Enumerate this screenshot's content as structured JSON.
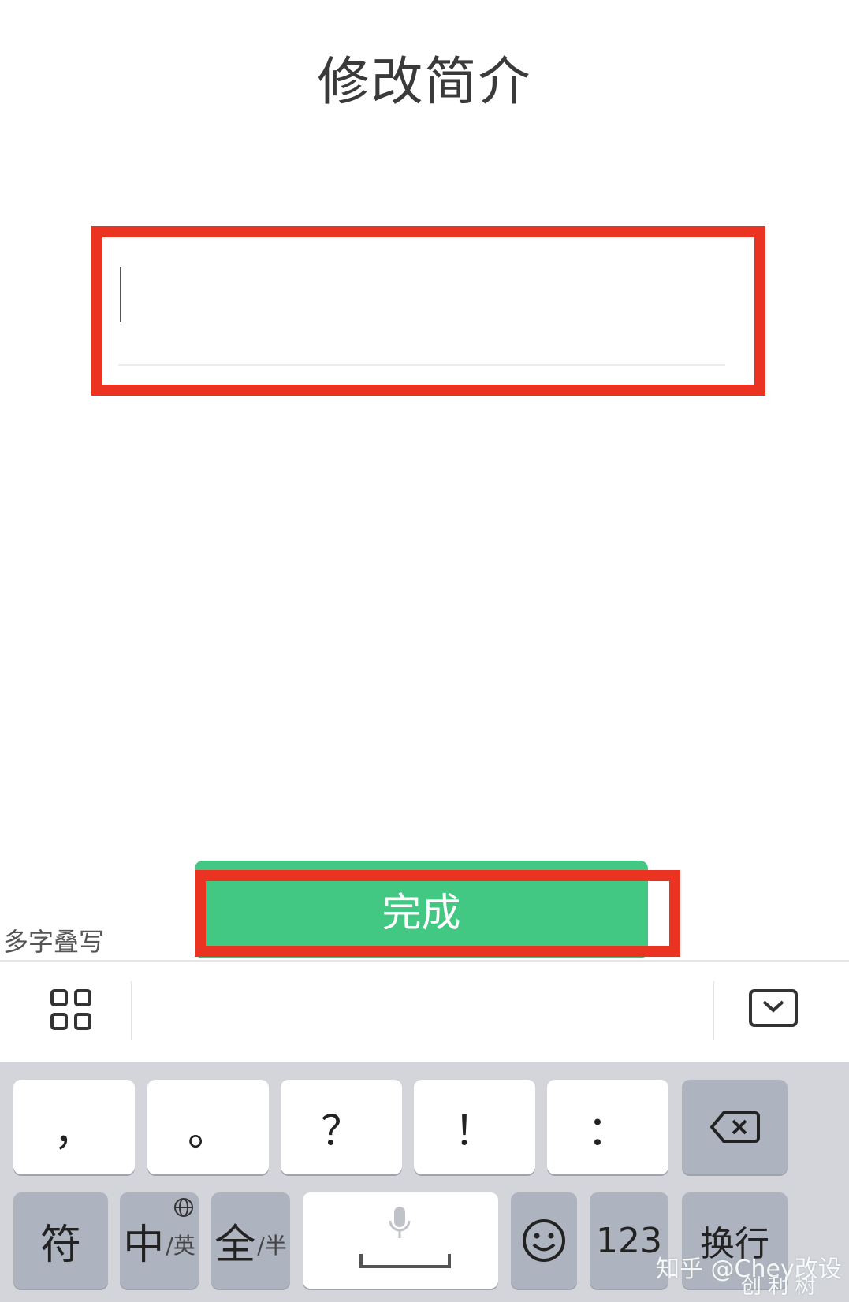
{
  "page": {
    "title": "修改简介"
  },
  "bio_input": {
    "value": ""
  },
  "done_button": {
    "label": "完成"
  },
  "keyboard": {
    "candidate_hint": "多字叠写",
    "toolbar": {
      "menu_icon": "grid-icon",
      "collapse_icon": "keyboard-collapse-icon"
    },
    "row1": [
      {
        "label": "，",
        "name": "key-comma"
      },
      {
        "label": "。",
        "name": "key-period"
      },
      {
        "label": "？",
        "name": "key-question"
      },
      {
        "label": "！",
        "name": "key-exclamation"
      },
      {
        "label": "：",
        "name": "key-colon"
      }
    ],
    "backspace_icon": "backspace-icon",
    "symbols_key": "符",
    "lang_key": {
      "main": "中",
      "sub": "/英"
    },
    "width_key": {
      "main": "全",
      "sub": "/半"
    },
    "emoji_icon": "emoji-icon",
    "numbers_key": "123",
    "return_key": "换行"
  },
  "watermark": {
    "line1": "知乎 @Chey改设",
    "line2": "创 利 树"
  },
  "colors": {
    "accent_green": "#42c882",
    "highlight_red": "#ea3321",
    "keyboard_bg": "#d3d5db"
  }
}
